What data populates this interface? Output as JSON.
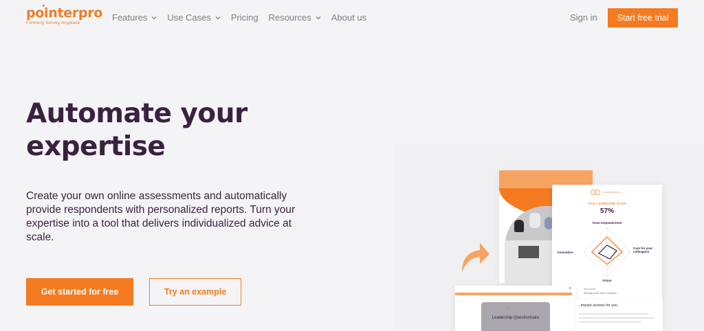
{
  "brand": {
    "name": "pointerpro",
    "tagline": "Formerly Survey Anyplace",
    "accent": "#f47b20",
    "dark": "#3b2140"
  },
  "nav": {
    "items": [
      {
        "label": "Features",
        "has_dropdown": true
      },
      {
        "label": "Use Cases",
        "has_dropdown": true
      },
      {
        "label": "Pricing",
        "has_dropdown": false
      },
      {
        "label": "Resources",
        "has_dropdown": true
      },
      {
        "label": "About us",
        "has_dropdown": false
      }
    ],
    "signin": "Sign in",
    "cta": "Start free trial"
  },
  "hero": {
    "headline": "Automate your expertise",
    "lead": "Create your own online assessments and automatically provide respondents with personalized reports. Turn your expertise into a tool that delivers individualized advice at scale.",
    "primary_button": "Get started for free",
    "secondary_button": "Try an example"
  },
  "illustration": {
    "report_card": {
      "score_label": "Your Leadership Score",
      "score_value": "57%",
      "axis_top": "Team empowerment",
      "axis_left": "Innovation",
      "axis_right": "Care for your colleagues",
      "axis_bottom": "Vision",
      "legend": [
        "Your score",
        "Average score other managers"
      ]
    },
    "questionnaire_card": {
      "title": "Leadership Questionnaire",
      "close_icon": "close-icon"
    },
    "actions_card": {
      "title": "...impact actions for you"
    }
  }
}
